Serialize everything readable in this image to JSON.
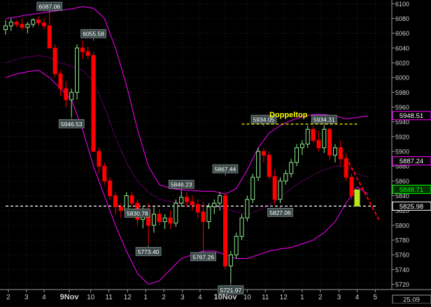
{
  "chart_data": {
    "type": "candlestick",
    "y_axis": {
      "ticks": [
        5720,
        5740,
        5760,
        5780,
        5800,
        5820,
        5840,
        5860,
        5880,
        5900,
        5920,
        5940,
        5960,
        5980,
        6000,
        6020,
        6040,
        6060,
        6080,
        6100
      ],
      "ylim": [
        5713,
        6105
      ],
      "side": "right"
    },
    "x_axis": {
      "labels": [
        {
          "text": "2",
          "x": 0.5
        },
        {
          "text": "3",
          "x": 3.8
        },
        {
          "text": "4",
          "x": 7.0
        },
        {
          "text": "9Nov",
          "x": 11.6
        },
        {
          "text": "10",
          "x": 15.5
        },
        {
          "text": "11",
          "x": 18.8
        },
        {
          "text": "12",
          "x": 22.2
        },
        {
          "text": "1",
          "x": 25.5
        },
        {
          "text": "2",
          "x": 28.8
        },
        {
          "text": "3",
          "x": 32.2
        },
        {
          "text": "4",
          "x": 35.4
        },
        {
          "text": "10Nov",
          "x": 40.0
        },
        {
          "text": "10",
          "x": 44.0
        },
        {
          "text": "11",
          "x": 47.3
        },
        {
          "text": "12",
          "x": 50.6
        },
        {
          "text": "1",
          "x": 54.0
        },
        {
          "text": "2",
          "x": 57.3
        },
        {
          "text": "3",
          "x": 60.7
        },
        {
          "text": "4",
          "x": 64.0
        },
        {
          "text": "5",
          "x": 67.3
        }
      ],
      "bold": [
        "9Nov",
        "10Nov"
      ]
    },
    "candles": [
      [
        6065,
        6078,
        6058,
        6070
      ],
      [
        6070,
        6080,
        6063,
        6075
      ],
      [
        6075,
        6078,
        6068,
        6072
      ],
      [
        6072,
        6080,
        6064,
        6068
      ],
      [
        6068,
        6075,
        6060,
        6072
      ],
      [
        6072,
        6080,
        6068,
        6078
      ],
      [
        6078,
        6083,
        6070,
        6074
      ],
      [
        6074,
        6080,
        6065,
        6070
      ],
      [
        6070,
        6087,
        6050,
        6040
      ],
      [
        6040,
        6045,
        6000,
        6005
      ],
      [
        6005,
        6010,
        5975,
        5985
      ],
      [
        5985,
        5995,
        5960,
        5970
      ],
      [
        5970,
        5985,
        5947,
        5980
      ],
      [
        5980,
        6045,
        5970,
        6040
      ],
      [
        6040,
        6050,
        6025,
        6035
      ],
      [
        6035,
        6042,
        6025,
        6030
      ],
      [
        6030,
        6035,
        5990,
        5900
      ],
      [
        5900,
        5905,
        5870,
        5880
      ],
      [
        5880,
        5885,
        5855,
        5860
      ],
      [
        5860,
        5865,
        5835,
        5840
      ],
      [
        5840,
        5845,
        5815,
        5825
      ],
      [
        5825,
        5830,
        5810,
        5820
      ],
      [
        5820,
        5845,
        5812,
        5840
      ],
      [
        5840,
        5845,
        5825,
        5830
      ],
      [
        5830,
        5835,
        5800,
        5808
      ],
      [
        5808,
        5825,
        5796,
        5820
      ],
      [
        5820,
        5830,
        5775,
        5800
      ],
      [
        5800,
        5825,
        5790,
        5815
      ],
      [
        5815,
        5822,
        5800,
        5805
      ],
      [
        5805,
        5815,
        5795,
        5810
      ],
      [
        5810,
        5820,
        5795,
        5803
      ],
      [
        5803,
        5835,
        5798,
        5830
      ],
      [
        5830,
        5846,
        5825,
        5838
      ],
      [
        5838,
        5845,
        5825,
        5832
      ],
      [
        5832,
        5840,
        5820,
        5828
      ],
      [
        5828,
        5835,
        5810,
        5818
      ],
      [
        5818,
        5832,
        5768,
        5805
      ],
      [
        5805,
        5830,
        5795,
        5825
      ],
      [
        5825,
        5835,
        5815,
        5830
      ],
      [
        5830,
        5845,
        5820,
        5840
      ],
      [
        5840,
        5845,
        5740,
        5745
      ],
      [
        5745,
        5765,
        5722,
        5760
      ],
      [
        5760,
        5790,
        5755,
        5785
      ],
      [
        5785,
        5815,
        5780,
        5810
      ],
      [
        5810,
        5840,
        5805,
        5835
      ],
      [
        5835,
        5870,
        5830,
        5865
      ],
      [
        5865,
        5905,
        5860,
        5900
      ],
      [
        5900,
        5905,
        5885,
        5895
      ],
      [
        5895,
        5900,
        5862,
        5866
      ],
      [
        5866,
        5875,
        5828,
        5835
      ],
      [
        5835,
        5865,
        5830,
        5860
      ],
      [
        5860,
        5875,
        5855,
        5870
      ],
      [
        5870,
        5890,
        5865,
        5885
      ],
      [
        5885,
        5910,
        5880,
        5905
      ],
      [
        5905,
        5915,
        5895,
        5910
      ],
      [
        5910,
        5935,
        5905,
        5930
      ],
      [
        5930,
        5935,
        5912,
        5915
      ],
      [
        5915,
        5928,
        5900,
        5905
      ],
      [
        5905,
        5935,
        5898,
        5930
      ],
      [
        5930,
        5932,
        5888,
        5895
      ],
      [
        5895,
        5910,
        5885,
        5905
      ],
      [
        5905,
        5915,
        5880,
        5890
      ],
      [
        5890,
        5898,
        5860,
        5865
      ],
      [
        5865,
        5870,
        5835,
        5840
      ],
      [
        5840,
        5848,
        5826,
        5844
      ]
    ],
    "bollinger": {
      "upper": [
        [
          0,
          6080
        ],
        [
          2,
          6082
        ],
        [
          4,
          6085
        ],
        [
          6,
          6087
        ],
        [
          8,
          6089
        ],
        [
          10,
          6091
        ],
        [
          12,
          6093
        ],
        [
          14,
          6096
        ],
        [
          16,
          6094
        ],
        [
          18,
          6080
        ],
        [
          20,
          6040
        ],
        [
          22,
          5990
        ],
        [
          24,
          5930
        ],
        [
          26,
          5880
        ],
        [
          28,
          5855
        ],
        [
          30,
          5850
        ],
        [
          32,
          5848
        ],
        [
          34,
          5847
        ],
        [
          36,
          5846
        ],
        [
          38,
          5846
        ],
        [
          40,
          5842
        ],
        [
          42,
          5850
        ],
        [
          44,
          5875
        ],
        [
          46,
          5905
        ],
        [
          48,
          5925
        ],
        [
          50,
          5935
        ],
        [
          52,
          5942
        ],
        [
          54,
          5947
        ],
        [
          56,
          5950
        ],
        [
          58,
          5950
        ],
        [
          60,
          5948
        ],
        [
          62,
          5944
        ],
        [
          64,
          5946
        ],
        [
          66,
          5948
        ]
      ],
      "middle": [
        [
          0,
          6020
        ],
        [
          2,
          6025
        ],
        [
          4,
          6028
        ],
        [
          6,
          6030
        ],
        [
          8,
          6027
        ],
        [
          10,
          6020
        ],
        [
          12,
          6015
        ],
        [
          14,
          6010
        ],
        [
          16,
          5995
        ],
        [
          18,
          5960
        ],
        [
          20,
          5920
        ],
        [
          22,
          5885
        ],
        [
          24,
          5860
        ],
        [
          26,
          5845
        ],
        [
          28,
          5835
        ],
        [
          30,
          5832
        ],
        [
          32,
          5830
        ],
        [
          34,
          5828
        ],
        [
          36,
          5827
        ],
        [
          38,
          5826
        ],
        [
          40,
          5822
        ],
        [
          42,
          5818
        ],
        [
          44,
          5815
        ],
        [
          46,
          5820
        ],
        [
          48,
          5828
        ],
        [
          50,
          5838
        ],
        [
          52,
          5850
        ],
        [
          54,
          5860
        ],
        [
          56,
          5868
        ],
        [
          58,
          5875
        ],
        [
          60,
          5880
        ],
        [
          62,
          5880
        ],
        [
          64,
          5870
        ],
        [
          66,
          5865
        ]
      ],
      "lower": [
        [
          0,
          6000
        ],
        [
          2,
          6005
        ],
        [
          4,
          6008
        ],
        [
          6,
          6010
        ],
        [
          8,
          6000
        ],
        [
          10,
          5985
        ],
        [
          12,
          5970
        ],
        [
          14,
          5930
        ],
        [
          16,
          5880
        ],
        [
          18,
          5840
        ],
        [
          20,
          5800
        ],
        [
          22,
          5765
        ],
        [
          24,
          5735
        ],
        [
          26,
          5720
        ],
        [
          28,
          5725
        ],
        [
          30,
          5740
        ],
        [
          32,
          5755
        ],
        [
          34,
          5760
        ],
        [
          36,
          5765
        ],
        [
          38,
          5765
        ],
        [
          40,
          5760
        ],
        [
          42,
          5755
        ],
        [
          44,
          5755
        ],
        [
          46,
          5760
        ],
        [
          48,
          5765
        ],
        [
          50,
          5768
        ],
        [
          52,
          5770
        ],
        [
          54,
          5775
        ],
        [
          56,
          5780
        ],
        [
          58,
          5790
        ],
        [
          60,
          5805
        ],
        [
          62,
          5830
        ],
        [
          64,
          5852
        ],
        [
          66,
          5842
        ]
      ]
    },
    "annotations": [
      {
        "text": "6087.06",
        "x": 8,
        "y": 6087
      },
      {
        "text": "6055.58",
        "x": 16,
        "y": 6050
      },
      {
        "text": "5946.53",
        "x": 12,
        "y": 5947
      },
      {
        "text": "5830.78",
        "x": 24,
        "y": 5826
      },
      {
        "text": "5773.40",
        "x": 26,
        "y": 5774
      },
      {
        "text": "5846.23",
        "x": 32,
        "y": 5846
      },
      {
        "text": "5867.44",
        "x": 40,
        "y": 5867
      },
      {
        "text": "5767.26",
        "x": 36,
        "y": 5767
      },
      {
        "text": "5721.97",
        "x": 41,
        "y": 5722
      },
      {
        "text": "5934.05",
        "x": 47,
        "y": 5934
      },
      {
        "text": "5934.31",
        "x": 58,
        "y": 5934
      },
      {
        "text": "5827.06",
        "x": 50,
        "y": 5827
      }
    ],
    "title_text": "Doppeltop",
    "hlines": [
      {
        "y": 5937,
        "x0": 43,
        "x1": 64,
        "color": "#ffff00"
      },
      {
        "y": 5826,
        "x0": 0,
        "x1": 67.5,
        "color": "#ffffff"
      }
    ],
    "trendline": {
      "from": [
        62,
        5892
      ],
      "to": [
        68,
        5807
      ],
      "color": "#ff0000"
    },
    "price_labels": [
      {
        "text": "5948.51",
        "y": 5948.51,
        "color": "#ff00ff"
      },
      {
        "text": "5887.24",
        "y": 5887.24,
        "color": "#ff00ff"
      },
      {
        "text": "5848.71",
        "y": 5848.71,
        "color": "#00ff00"
      },
      {
        "text": "5825.98",
        "y": 5825.98,
        "color": "#ffffff"
      }
    ],
    "bottom_right_label": "25.09",
    "colors": {
      "up": "#90ee90",
      "down": "#ff0000",
      "bollinger": "#ff00ff",
      "grid": "#3a3a3a",
      "text": "#ffffff",
      "axis": "#9a9a9a"
    }
  }
}
